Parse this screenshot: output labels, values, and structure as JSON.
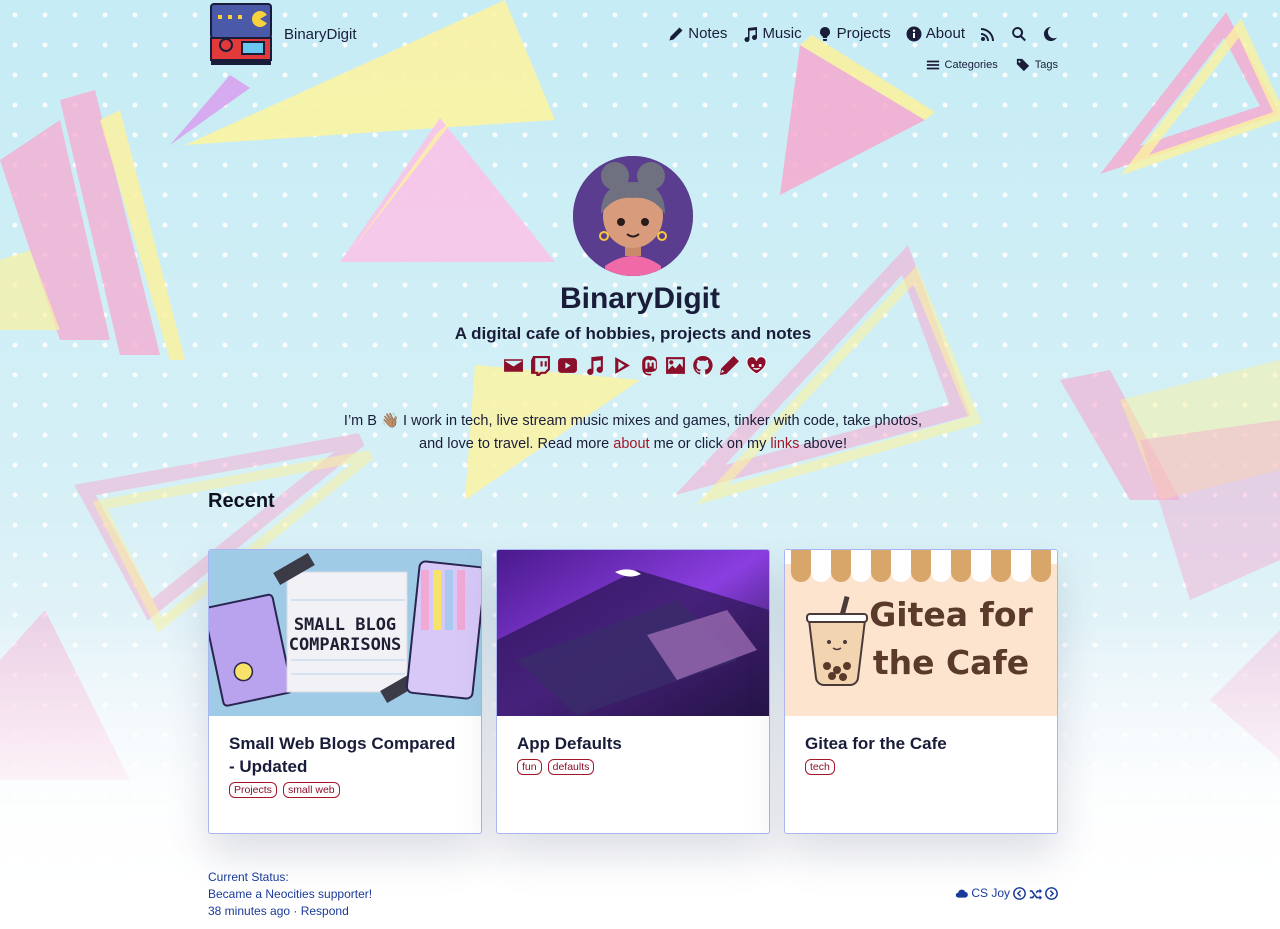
{
  "site": {
    "name": "BinaryDigit"
  },
  "nav": {
    "items": [
      {
        "label": "Notes",
        "icon": "pencil-icon"
      },
      {
        "label": "Music",
        "icon": "music-note-icon"
      },
      {
        "label": "Projects",
        "icon": "lightbulb-icon"
      },
      {
        "label": "About",
        "icon": "info-icon"
      }
    ],
    "utility_icons": [
      "rss-icon",
      "search-icon",
      "moon-icon"
    ],
    "sub": [
      {
        "label": "Categories",
        "icon": "list-icon"
      },
      {
        "label": "Tags",
        "icon": "tag-icon"
      }
    ]
  },
  "hero": {
    "title": "BinaryDigit",
    "subtitle": "A digital cafe of hobbies, projects and notes",
    "social_icons": [
      "email-icon",
      "twitch-icon",
      "youtube-icon",
      "music-icon",
      "play-icon",
      "mastodon-icon",
      "image-icon",
      "github-icon",
      "pencil-icon",
      "heart-face-icon"
    ],
    "intro_part1": "I’m B 👋🏽 I work in tech, live stream music mixes and games, tinker with code, take photos, and love to travel. Read more ",
    "intro_link1": "about",
    "intro_part2": " me or click on my ",
    "intro_link2": "links",
    "intro_part3": " above!"
  },
  "recent": {
    "heading": "Recent",
    "posts": [
      {
        "title": "Small Web Blogs Compared - Updated",
        "image_text_1": "SMALL BLOG",
        "image_text_2": "COMPARISONS",
        "tags": [
          "Projects",
          "small web"
        ]
      },
      {
        "title": "App Defaults",
        "tags": [
          "fun",
          "defaults"
        ]
      },
      {
        "title": "Gitea for the Cafe",
        "image_text_1": "Gitea for",
        "image_text_2": "the Cafe",
        "tags": [
          "tech"
        ]
      }
    ]
  },
  "footer": {
    "status_label": "Current Status:",
    "status_text": "Became a Neocities supporter!",
    "status_meta": "38 minutes ago · Respond",
    "webring_label": "CS Joy"
  },
  "colors": {
    "accent": "#a3172b",
    "text": "#1a1d3a",
    "link": "#1a3a9a",
    "card_border": "#aab6f2"
  }
}
